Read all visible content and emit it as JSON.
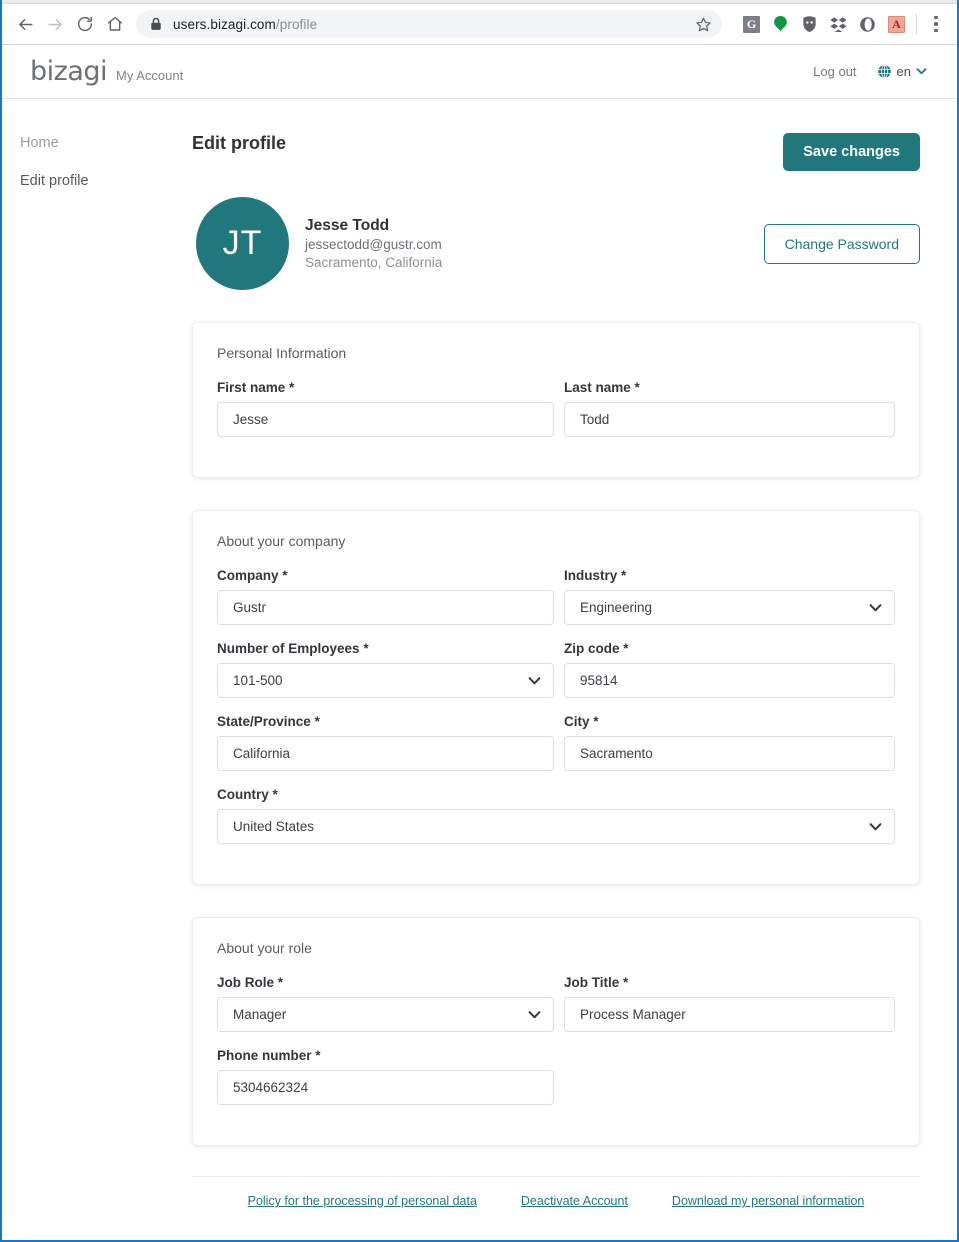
{
  "browser": {
    "url_host": "users.bizagi.com",
    "url_path": "/profile",
    "icons": {
      "back": "back-arrow-icon",
      "forward": "forward-arrow-icon",
      "reload": "reload-icon",
      "home": "home-icon",
      "lock": "lock-icon",
      "star": "star-bookmark-icon",
      "menu": "three-dot-menu-icon"
    },
    "extensions": [
      {
        "name": "grammarly-extension-icon",
        "label": "G"
      },
      {
        "name": "green-pin-extension-icon",
        "label": ""
      },
      {
        "name": "shield-extension-icon",
        "label": ""
      },
      {
        "name": "dropbox-extension-icon",
        "label": ""
      },
      {
        "name": "opera-circle-extension-icon",
        "label": ""
      },
      {
        "name": "adobe-acrobat-extension-icon",
        "label": "A"
      }
    ]
  },
  "header": {
    "logo": "bizagi",
    "subtitle": "My Account",
    "logout_label": "Log out",
    "language_code": "en",
    "globe_icon": "globe-icon",
    "chevron_icon": "chevron-down-icon"
  },
  "sidebar": {
    "items": [
      {
        "label": "Home",
        "state": "inactive"
      },
      {
        "label": "Edit profile",
        "state": "active"
      }
    ]
  },
  "main": {
    "page_title": "Edit profile",
    "save_button": "Save changes",
    "change_password_button": "Change Password",
    "profile": {
      "initials": "JT",
      "name": "Jesse Todd",
      "email": "jessectodd@gustr.com",
      "location": "Sacramento, California"
    },
    "cards": [
      {
        "title": "Personal Information",
        "fields": [
          {
            "label": "First name",
            "required": "*",
            "value": "Jesse",
            "type": "text",
            "span": "half"
          },
          {
            "label": "Last name",
            "required": "*",
            "value": "Todd",
            "type": "text",
            "span": "half"
          }
        ]
      },
      {
        "title": "About your company",
        "fields": [
          {
            "label": "Company",
            "required": "*",
            "value": "Gustr",
            "type": "text",
            "span": "half"
          },
          {
            "label": "Industry",
            "required": "*",
            "value": "Engineering",
            "type": "select",
            "span": "half"
          },
          {
            "label": "Number of Employees",
            "required": "*",
            "value": "101-500",
            "type": "select",
            "span": "half"
          },
          {
            "label": "Zip code",
            "required": "*",
            "value": "95814",
            "type": "text",
            "span": "half"
          },
          {
            "label": "State/Province",
            "required": "*",
            "value": "California",
            "type": "text",
            "span": "half"
          },
          {
            "label": "City",
            "required": "*",
            "value": "Sacramento",
            "type": "text",
            "span": "half"
          },
          {
            "label": "Country",
            "required": "*",
            "value": "United States",
            "type": "select",
            "span": "full"
          }
        ]
      },
      {
        "title": "About your role",
        "fields": [
          {
            "label": "Job Role",
            "required": "*",
            "value": "Manager",
            "type": "select",
            "span": "half"
          },
          {
            "label": "Job Title",
            "required": "*",
            "value": "Process Manager",
            "type": "text",
            "span": "half"
          },
          {
            "label": "Phone number",
            "required": "*",
            "value": "5304662324",
            "type": "text",
            "span": "half"
          }
        ]
      }
    ]
  },
  "footer": {
    "links": [
      "Policy for the processing of personal data",
      "Deactivate Account",
      "Download my personal information"
    ]
  },
  "colors": {
    "brand_teal": "#21787c",
    "window_border_blue": "#1578c8",
    "logo_gray": "#6e7174"
  }
}
